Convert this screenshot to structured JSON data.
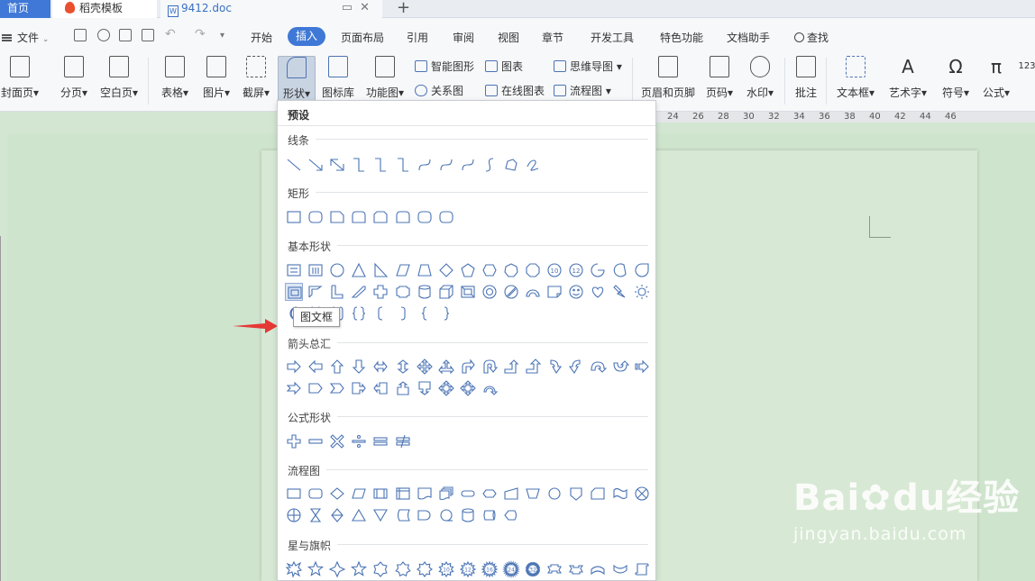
{
  "tabs": {
    "home": "首页",
    "daoke": "稻壳模板",
    "doc": "9412.doc"
  },
  "menubar": {
    "file": "文件",
    "items": [
      "开始",
      "插入",
      "页面布局",
      "引用",
      "审阅",
      "视图",
      "章节",
      "开发工具",
      "特色功能",
      "文档助手",
      "查找"
    ],
    "active": "插入"
  },
  "ribbon": {
    "cover": "封面页",
    "page_break": "分页",
    "blank": "空白页",
    "table": "表格",
    "picture": "图片",
    "screenshot": "截屏",
    "shape": "形状",
    "icon_lib": "图标库",
    "function_chart": "功能图",
    "smart_graphic": "智能图形",
    "chart": "图表",
    "mind_map": "思维导图",
    "relation": "关系图",
    "online_chart": "在线图表",
    "flowchart": "流程图",
    "header_footer": "页眉和页脚",
    "page_number": "页码",
    "watermark": "水印",
    "comment": "批注",
    "textbox": "文本框",
    "wordart": "艺术字",
    "symbol": "符号",
    "formula": "公式"
  },
  "ruler": [
    "24",
    "26",
    "28",
    "30",
    "32",
    "34",
    "36",
    "38",
    "40",
    "42",
    "44",
    "46"
  ],
  "dropdown": {
    "title": "预设",
    "sections": {
      "lines": "线条",
      "rect": "矩形",
      "basic": "基本形状",
      "arrows": "箭头总汇",
      "formula": "公式形状",
      "flow": "流程图",
      "stars": "星与旗帜"
    },
    "tooltip": "图文框"
  },
  "watermark": {
    "logo_left": "Bai",
    "logo_right": "du经验",
    "url": "jingyan.baidu.com"
  },
  "colors": {
    "accent": "#3f78d6",
    "shape_stroke": "#4b74b5",
    "arrow": "#e53935"
  }
}
